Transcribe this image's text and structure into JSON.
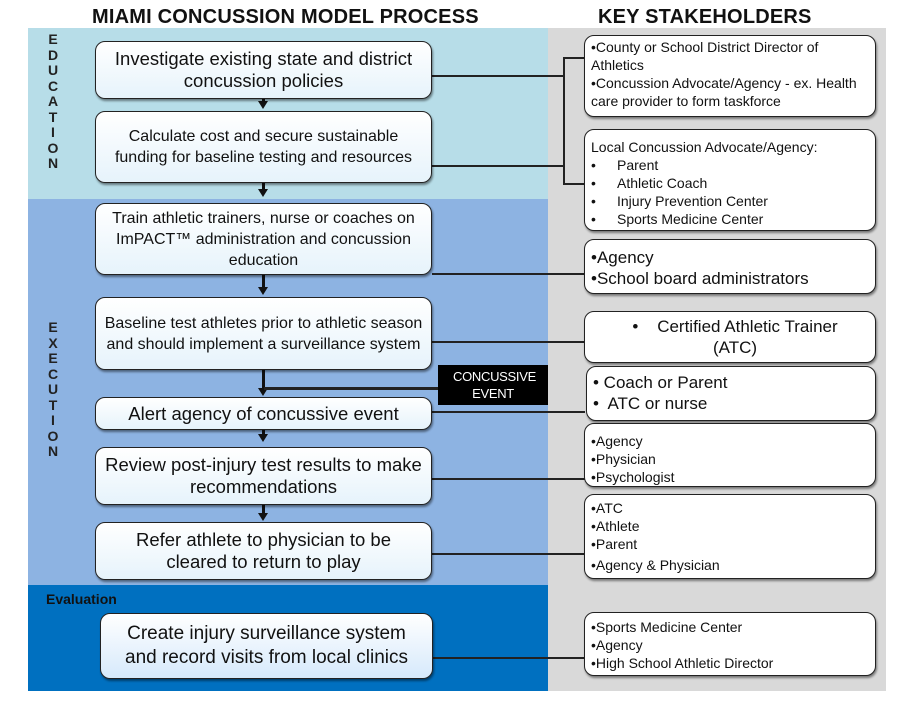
{
  "header": {
    "process_title": "MIAMI CONCUSSION MODEL PROCESS",
    "stakeholders_title": "KEY STAKEHOLDERS"
  },
  "phases": {
    "education": {
      "label": "EDUCATION",
      "color": "#b7dde8"
    },
    "execution": {
      "label": "EXECUTION",
      "color": "#8db3e2"
    },
    "evaluation": {
      "label": "Evaluation",
      "color": "#0070c0"
    }
  },
  "steps": [
    {
      "text": "Investigate existing state and district concussion policies",
      "phase": "education"
    },
    {
      "text": "Calculate cost and secure sustainable funding for baseline testing and resources",
      "phase": "education"
    },
    {
      "text": "Train athletic trainers, nurse or coaches on ImPACT™ administration and concussion education",
      "phase": "execution"
    },
    {
      "text": "Baseline test athletes prior to athletic season and should implement a surveillance system",
      "phase": "execution"
    },
    {
      "text": "Alert agency of concussive event",
      "phase": "execution"
    },
    {
      "text": "Review post-injury test results to make recommendations",
      "phase": "execution"
    },
    {
      "text": "Refer athlete to physician to be cleared to return to play",
      "phase": "execution"
    },
    {
      "text": "Create injury surveillance system and record visits from local clinics",
      "phase": "evaluation"
    }
  ],
  "event": {
    "label": "CONCUSSIVE EVENT"
  },
  "stakeholders": [
    {
      "items": [
        "•County or School District Director of Athletics",
        "•Concussion  Advocate/Agency - ex. Health care provider to form taskforce"
      ]
    },
    {
      "heading": "Local Concussion  Advocate/Agency:",
      "items": [
        "Parent",
        "Athletic Coach",
        "Injury Prevention Center",
        "Sports Medicine Center"
      ]
    },
    {
      "items": [
        "•Agency",
        "•School board administrators"
      ]
    },
    {
      "items": [
        "•    Certified Athletic Trainer (ATC)"
      ]
    },
    {
      "items": [
        "• Coach or Parent",
        "•  ATC or nurse"
      ]
    },
    {
      "items": [
        "•Agency",
        "•Physician",
        "•Psychologist"
      ]
    },
    {
      "items": [
        "•ATC",
        "•Athlete",
        "•Parent",
        "•Agency & Physician"
      ]
    },
    {
      "items": [
        "•Sports Medicine Center",
        "•Agency",
        "•High School Athletic Director"
      ]
    }
  ]
}
